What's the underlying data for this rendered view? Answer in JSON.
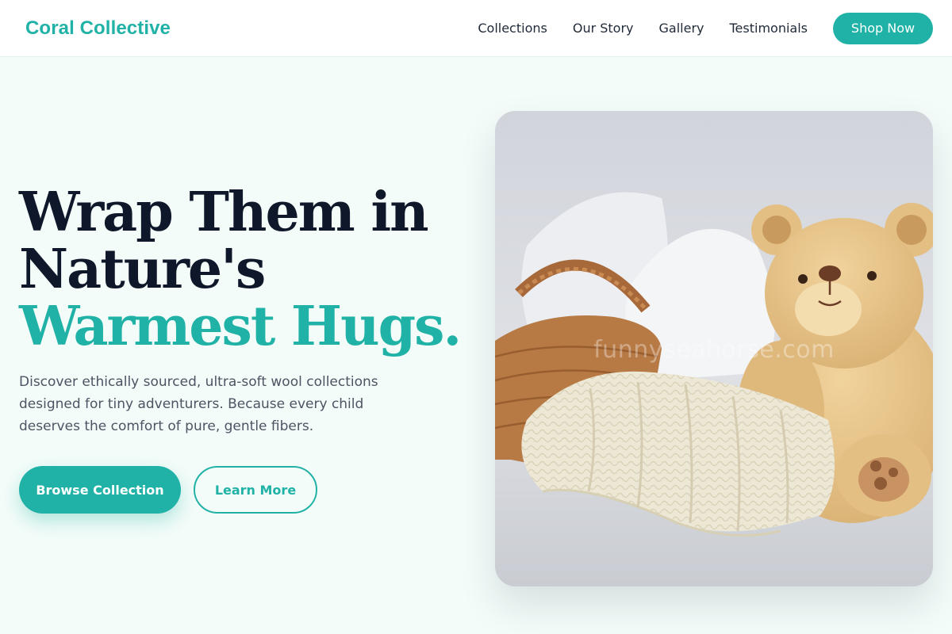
{
  "brand": {
    "name": "Coral Collective"
  },
  "nav": {
    "links": [
      "Collections",
      "Our Story",
      "Gallery",
      "Testimonials"
    ],
    "cta": "Shop Now"
  },
  "hero": {
    "headline_lines": [
      "Wrap Them in",
      "Nature's"
    ],
    "headline_accent": "Warmest Hugs.",
    "subtext": "Discover ethically sourced, ultra-soft wool collections designed for tiny adventurers. Because every child deserves the comfort of pure, gentle fibers.",
    "primary_button": "Browse Collection",
    "secondary_button": "Learn More",
    "image_watermark": "funnyseahorse.com"
  },
  "colors": {
    "accent": "#20b2a6",
    "heading": "#0f172a",
    "body_text": "#4b5563",
    "page_background": "#f3fcf9"
  }
}
